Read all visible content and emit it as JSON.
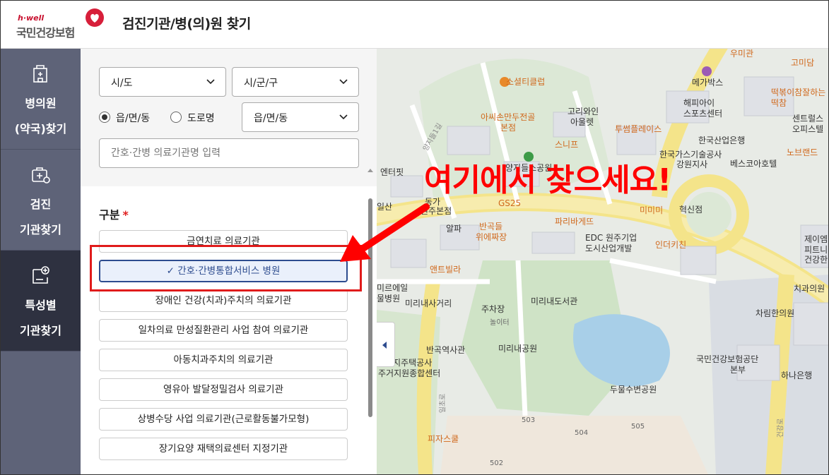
{
  "header": {
    "logo_top": "h·well",
    "logo_main": "국민건강보험",
    "title": "검진기관/병(의)원 찾기"
  },
  "nav": [
    {
      "line1": "병의원",
      "line2": "(약국)찾기"
    },
    {
      "line1": "검진",
      "line2": "기관찾기"
    },
    {
      "line1": "특성별",
      "line2": "기관찾기"
    }
  ],
  "filters": {
    "sido": "시/도",
    "sigungu": "시/군/구",
    "radio_eup": "읍/면/동",
    "radio_road": "도로명",
    "dong": "읍/면/동",
    "search_placeholder": "간호·간병 의료기관명 입력"
  },
  "category": {
    "label": "구분",
    "required_mark": "*",
    "items": [
      "금연치료 의료기관",
      "✓ 간호·간병통합서비스 병원",
      "장애인 건강(치과)주치의 의료기관",
      "일차의료 만성질환관리 사업 참여 의료기관",
      "아동치과주치의 의료기관",
      "영유아 발달정밀검사 의료기관",
      "상병수당 사업 의료기관(근로활동불가모형)",
      "장기요양 재택의료센터 지정기관"
    ]
  },
  "annotation": {
    "text": "여기에서 찾으세요!"
  },
  "map": {
    "labels": [
      "우미관",
      "고미담",
      "메가박스",
      "떡볶이참잘하는",
      "떡참",
      "센트럴스",
      "오피스텔",
      "소셜티클럽",
      "해피아이",
      "스포츠센터",
      "아씨손만두전골",
      "본점",
      "고리와인",
      "아울렛",
      "투썸플레이스",
      "한국산업은행",
      "노브랜드",
      "한국가스기술공사",
      "강원지사",
      "양지들소공원",
      "스니프",
      "양지들1길",
      "엔터핏",
      "베스코아호텔",
      "GS25",
      "혁신점",
      "미미미",
      "원주본점",
      "반곡들",
      "위에짜장",
      "알파",
      "파리바게뜨",
      "EDC 원주기업",
      "도시산업개발",
      "인더키친",
      "제이엠",
      "피트니",
      "앤트빌라",
      "건강한",
      "치과의원",
      "미리내사거리",
      "미리내도서관",
      "주차장",
      "놀이터",
      "차림한의원",
      "반곡역사관",
      "미리내공원",
      "국민건강보험공단",
      "본부",
      "토지주택공사",
      "주거지원종합센터",
      "하나은행",
      "두물수변공원",
      "피자스쿨",
      "503",
      "504",
      "505",
      "502",
      "일초로",
      "건강로",
      "미르에일",
      "물병원",
      "일산",
      "동가"
    ]
  },
  "colors": {
    "nav_bg": "#5e6378",
    "nav_active": "#2e3140",
    "selected_border": "#2d4c8f",
    "annotation_red": "#ff0000",
    "brand_red": "#c8102e"
  }
}
